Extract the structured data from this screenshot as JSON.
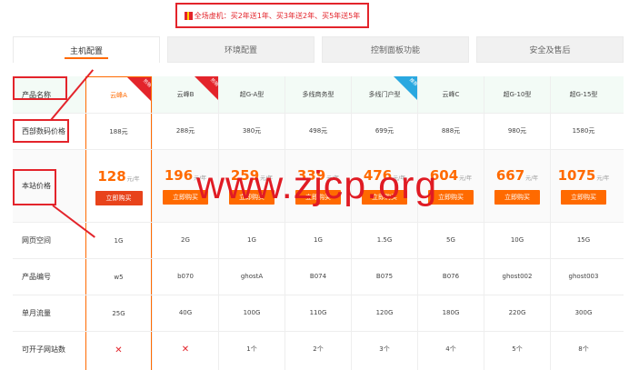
{
  "promo": {
    "text": "全场虚机：买2年送1年、买3年送2年、买5年送5年"
  },
  "tabs": [
    {
      "label": "主机配置",
      "active": true
    },
    {
      "label": "环境配置",
      "active": false
    },
    {
      "label": "控制面板功能",
      "active": false
    },
    {
      "label": "安全及售后",
      "active": false
    }
  ],
  "row_labels": {
    "name": "产品名称",
    "market_price": "西部数码价格",
    "site_price": "本站价格",
    "space": "网页空间",
    "code": "产品编号",
    "traffic": "单月流量",
    "sites": "可开子网站数"
  },
  "price_unit": "元/年",
  "buy_label": "立即购买",
  "ribbon_hot": "热销",
  "ribbon_rec": "推荐",
  "products": [
    {
      "name": "云峰A",
      "market": "188元",
      "price": "128",
      "space": "1G",
      "code": "w5",
      "traffic": "25G",
      "sites": "✕",
      "ribbon": "hot"
    },
    {
      "name": "云峰B",
      "market": "288元",
      "price": "196",
      "space": "2G",
      "code": "b070",
      "traffic": "40G",
      "sites": "✕",
      "ribbon": "hot"
    },
    {
      "name": "超G-A型",
      "market": "380元",
      "price": "259",
      "space": "1G",
      "code": "ghostA",
      "traffic": "100G",
      "sites": "1个",
      "ribbon": ""
    },
    {
      "name": "多线商务型",
      "market": "498元",
      "price": "339",
      "space": "1G",
      "code": "B074",
      "traffic": "110G",
      "sites": "2个",
      "ribbon": ""
    },
    {
      "name": "多线门户型",
      "market": "699元",
      "price": "476",
      "space": "1.5G",
      "code": "B075",
      "traffic": "120G",
      "sites": "3个",
      "ribbon": "rec"
    },
    {
      "name": "云峰C",
      "market": "888元",
      "price": "604",
      "space": "5G",
      "code": "B076",
      "traffic": "180G",
      "sites": "4个",
      "ribbon": ""
    },
    {
      "name": "超G-10型",
      "market": "980元",
      "price": "667",
      "space": "10G",
      "code": "ghost002",
      "traffic": "220G",
      "sites": "5个",
      "ribbon": ""
    },
    {
      "name": "超G-15型",
      "market": "1580元",
      "price": "1075",
      "space": "15G",
      "code": "ghost003",
      "traffic": "300G",
      "sites": "8个",
      "ribbon": ""
    }
  ],
  "watermark": "www.zjcp.org",
  "colors": {
    "accent": "#ff6a00",
    "annotation": "#e3242b",
    "recommend": "#2aa8e0"
  }
}
